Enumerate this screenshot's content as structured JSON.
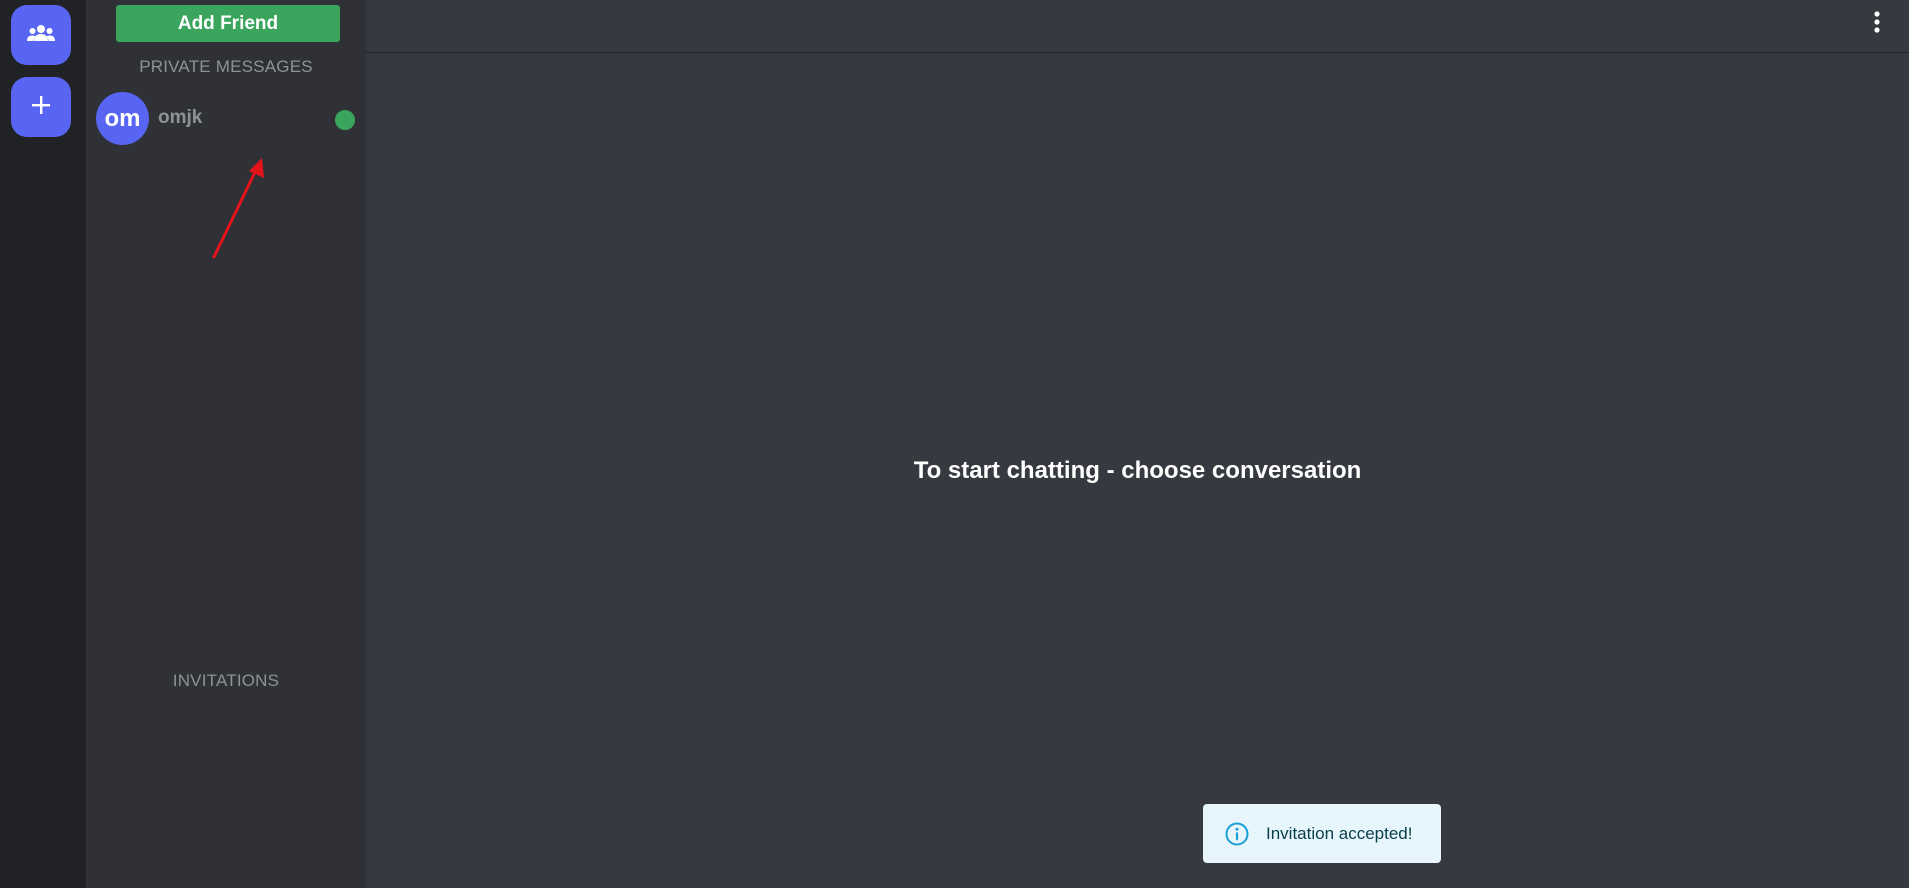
{
  "rail": {
    "friends_icon": "people-group-icon",
    "add_server_icon": "plus-icon"
  },
  "sidebar": {
    "add_friend_label": "Add Friend",
    "private_messages_heading": "PRIVATE MESSAGES",
    "invitations_heading": "INVITATIONS",
    "conversations": [
      {
        "avatar_initials": "om",
        "name": "omjk",
        "status": "online"
      }
    ]
  },
  "main": {
    "menu_icon": "more-vertical-icon",
    "empty_state": "To start chatting - choose conversation"
  },
  "toast": {
    "icon": "info-icon",
    "message": "Invitation accepted!"
  },
  "colors": {
    "brand": "#5865f2",
    "success": "#3ba55d",
    "annotation_arrow": "#e3141b",
    "toast_bg": "#e6f6fc",
    "toast_icon": "#1a9fd6"
  }
}
